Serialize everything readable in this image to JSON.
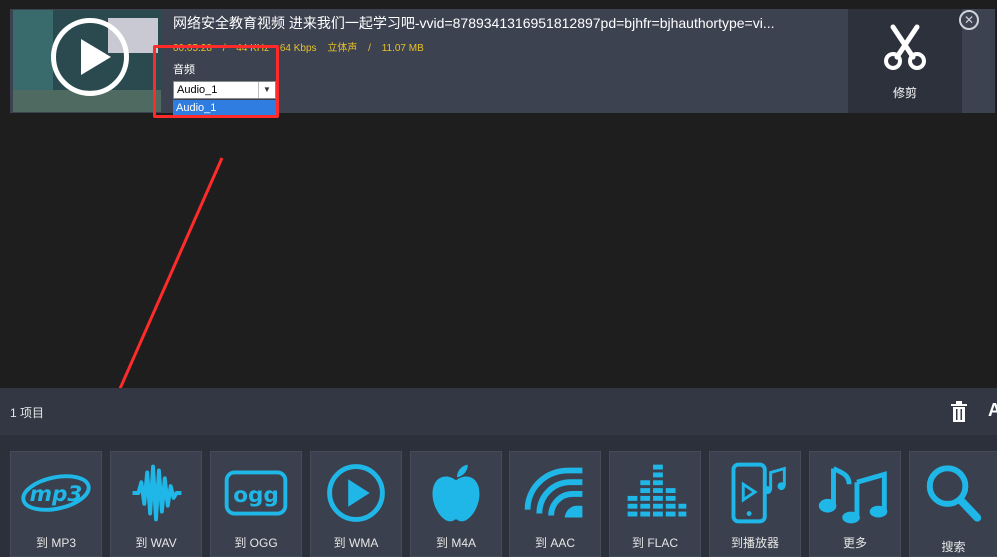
{
  "item": {
    "title": "网络安全教育视频 进来我们一起学习吧-vvid=878934131695181289​7pd=bjhfr=bjhauthortype=vi...",
    "duration": "00:05:28",
    "sample_rate": "44 KHz",
    "bitrate": "64 Kbps",
    "channels": "立体声",
    "size": "11.07 MB",
    "sep": "/",
    "audio_label": "音频",
    "audio_selected": "Audio_1",
    "audio_options": [
      "Audio_1"
    ],
    "trim_label": "修剪"
  },
  "status": {
    "count_label": "1 项目",
    "trailing_letter": "A"
  },
  "formats": [
    {
      "label": "到 MP3",
      "icon": "mp3-icon"
    },
    {
      "label": "到 WAV",
      "icon": "waveform-icon"
    },
    {
      "label": "到 OGG",
      "icon": "ogg-icon"
    },
    {
      "label": "到 WMA",
      "icon": "play-circle-icon"
    },
    {
      "label": "到 M4A",
      "icon": "apple-icon"
    },
    {
      "label": "到 AAC",
      "icon": "aac-wave-icon"
    },
    {
      "label": "到 FLAC",
      "icon": "equalizer-icon"
    },
    {
      "label": "到播放器",
      "icon": "phone-player-icon"
    },
    {
      "label": "更多",
      "icon": "music-notes-icon"
    },
    {
      "label": "搜索",
      "icon": "search-icon"
    }
  ],
  "colors": {
    "accent": "#1fb7e8",
    "highlight": "#ff2b2b",
    "meta_text": "#e8c228"
  }
}
